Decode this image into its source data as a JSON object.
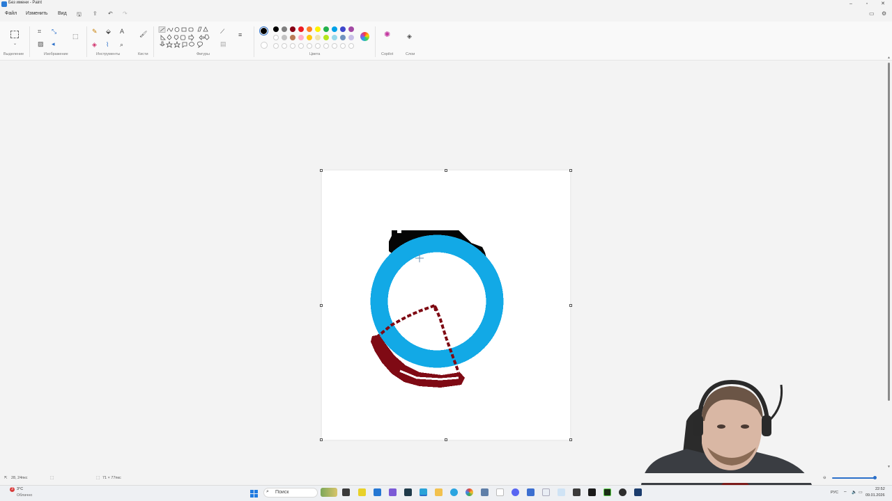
{
  "window": {
    "title": "Без имени - Paint"
  },
  "menu": {
    "items": [
      "Файл",
      "Изменить",
      "Вид"
    ]
  },
  "ribbon": {
    "groups": {
      "selection": "Выделение",
      "image": "Изображение",
      "tools": "Инструменты",
      "brushes": "Кисти",
      "shapes": "Фигуры",
      "colors": "Цвета",
      "copilot": "Copilot",
      "layers": "Слои"
    },
    "palette": [
      "#000000",
      "#7f7f7f",
      "#880015",
      "#ed1c24",
      "#ff7f27",
      "#fff200",
      "#22b14c",
      "#00a2e8",
      "#3f48cc",
      "#a349a4",
      "#ffffff",
      "#c3c3c3",
      "#b97a57",
      "#ffaec9",
      "#ffc90e",
      "#efe4b0",
      "#b5e61d",
      "#99d9ea",
      "#7092be",
      "#c8bfe7"
    ],
    "primary_color": "#000000"
  },
  "status": {
    "cursor_pos": "28, 24пкс",
    "canvas_size": "71 × 77пкс"
  },
  "taskbar": {
    "search_label": "Поиск",
    "weather_temp": "3°C",
    "weather_desc": "Облачно",
    "weather_badge": "3",
    "language": "РУС",
    "time": "22:52",
    "date": "09.01.2026"
  },
  "drawing": {
    "colors": {
      "blue": "#12a9e6",
      "black": "#050505",
      "maroon": "#7f0a14"
    }
  }
}
